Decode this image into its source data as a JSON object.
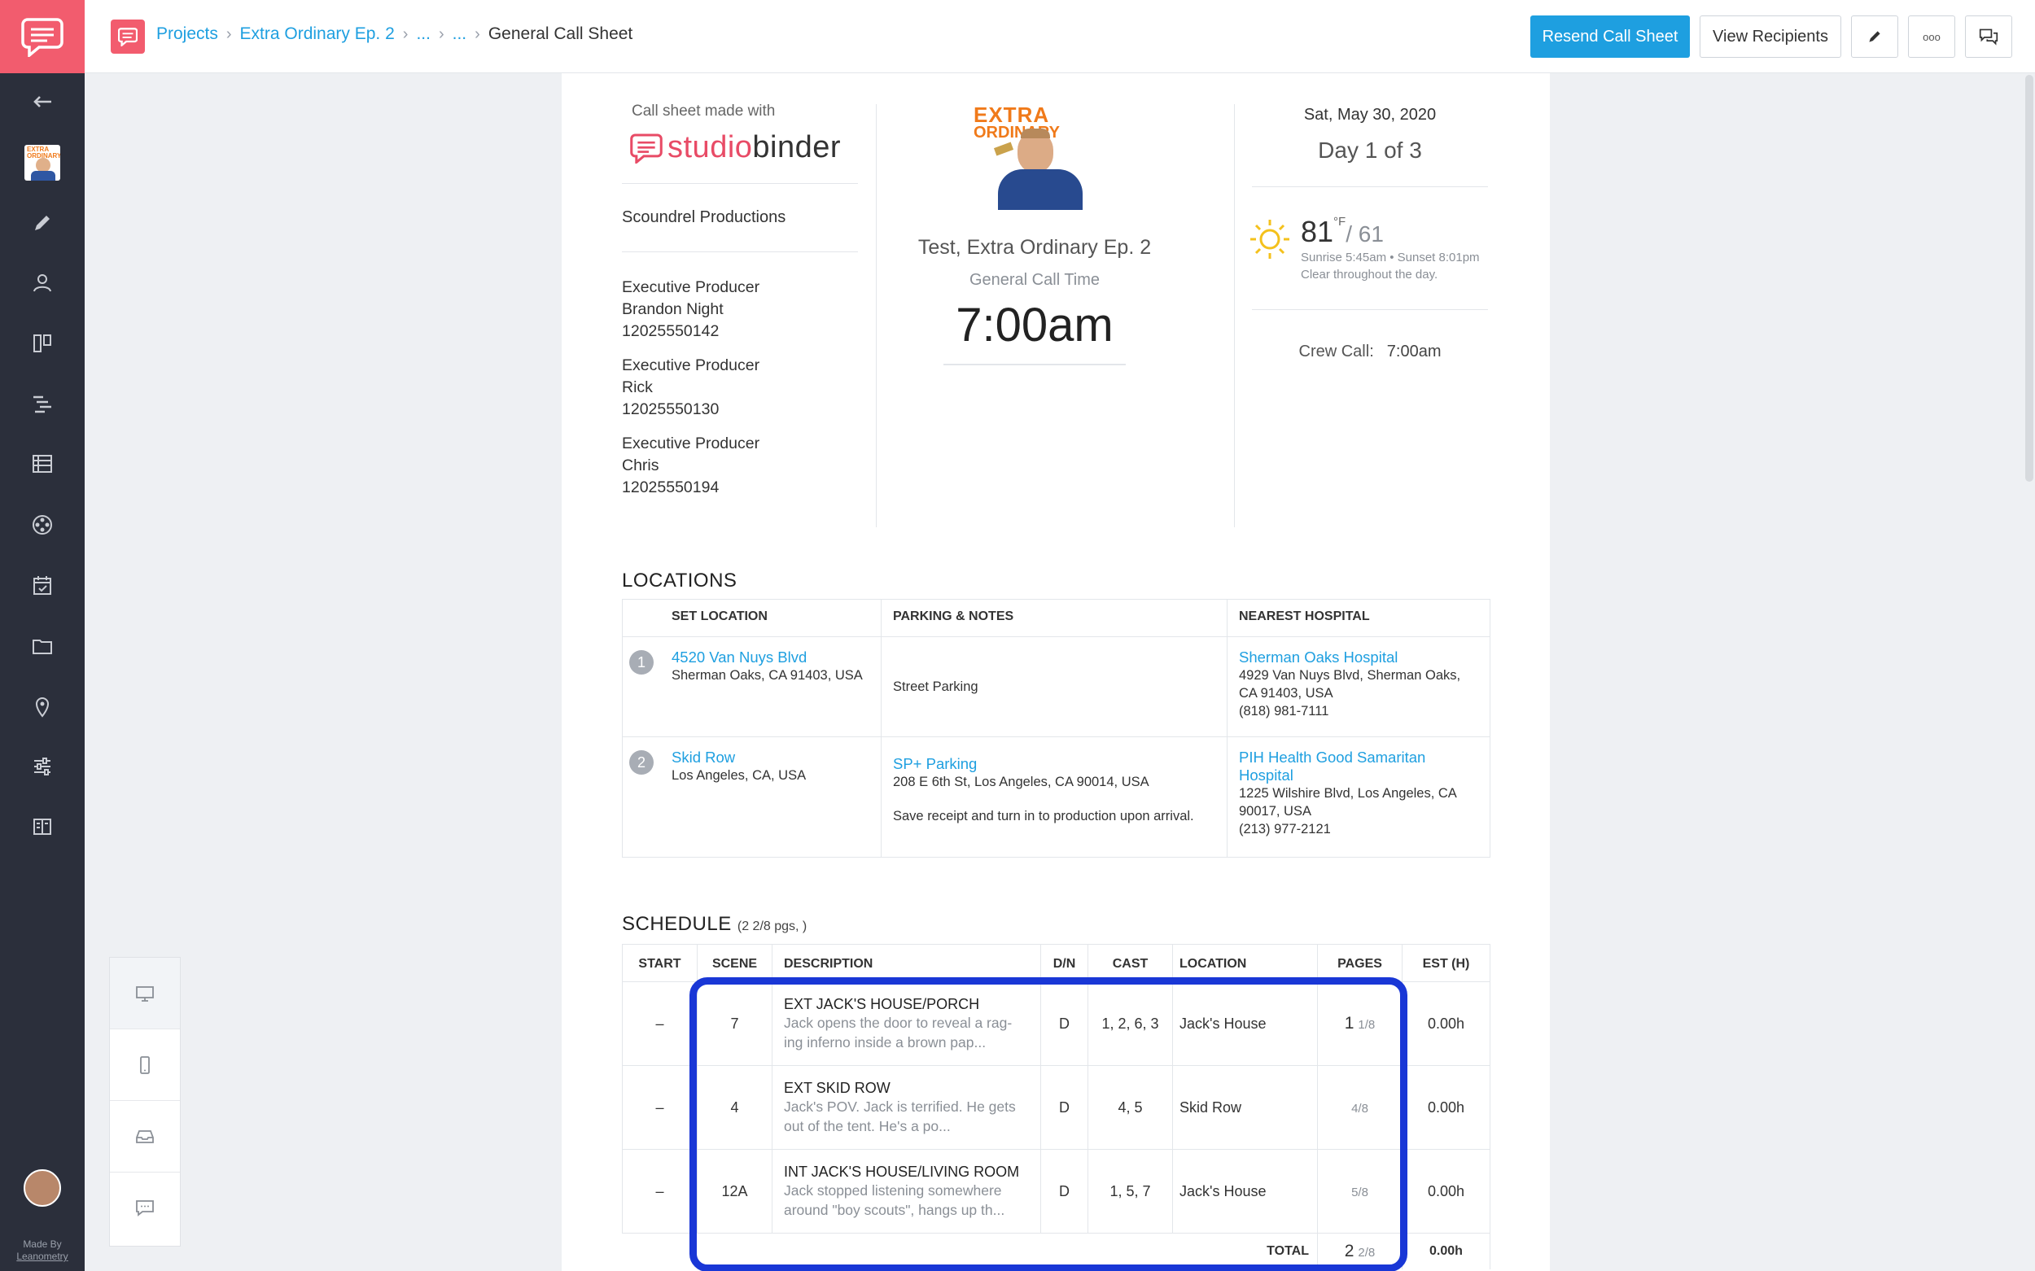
{
  "sidebar": {
    "icons": [
      "chat-logo-icon",
      "back-arrow-icon",
      "project-thumbnail",
      "pencil-icon",
      "user-group-icon",
      "board-icon",
      "gantt-icon",
      "list-icon",
      "film-reel-icon",
      "calendar-icon",
      "folder-icon",
      "location-pin-icon",
      "sliders-icon",
      "book-icon"
    ],
    "made_by_line1": "Made By",
    "made_by_line2": "Leanometry"
  },
  "breadcrumb": {
    "projects": "Projects",
    "episode": "Extra Ordinary Ep. 2",
    "ellipsis1": "...",
    "ellipsis2": "...",
    "current": "General Call Sheet"
  },
  "toolbar": {
    "resend_label": "Resend Call Sheet",
    "view_recipients_label": "View Recipients",
    "more_label": "ooo"
  },
  "header": {
    "made_with": "Call sheet made with",
    "brand_part1": "studio",
    "brand_part2": "binder",
    "company": "Scoundrel Productions",
    "producers": [
      {
        "role": "Executive Producer",
        "name": "Brandon Night",
        "phone": "12025550142"
      },
      {
        "role": "Executive Producer",
        "name": "Rick",
        "phone": "12025550130"
      },
      {
        "role": "Executive Producer",
        "name": "Chris",
        "phone": "12025550194"
      }
    ],
    "poster_line1": "EXTRA",
    "poster_line2": "ORDINARY",
    "show_title": "Test, Extra Ordinary Ep. 2",
    "general_call_label": "General Call Time",
    "general_call_time": "7:00am",
    "date": "Sat, May 30, 2020",
    "day": "Day 1 of 3",
    "temp_high": "81",
    "temp_unit": "°F",
    "temp_low": "/ 61",
    "sun_times": "Sunrise 5:45am • Sunset 8:01pm",
    "forecast": "Clear throughout the day.",
    "crew_call_label": "Crew Call:",
    "crew_call_time": "7:00am"
  },
  "locations": {
    "title": "LOCATIONS",
    "headers": [
      "SET LOCATION",
      "PARKING & NOTES",
      "NEAREST HOSPITAL"
    ],
    "rows": [
      {
        "num": "1",
        "name": "4520 Van Nuys Blvd",
        "address": "Sherman Oaks, CA 91403, USA",
        "parking_name": "",
        "parking_address": "",
        "notes": "Street Parking",
        "hospital_name": "Sherman Oaks Hospital",
        "hospital_address": "4929 Van Nuys Blvd, Sherman Oaks, CA 91403, USA",
        "hospital_phone": "(818) 981-7111"
      },
      {
        "num": "2",
        "name": "Skid Row",
        "address": "Los Angeles, CA, USA",
        "parking_name": "SP+ Parking",
        "parking_address": "208 E 6th St, Los Angeles, CA 90014, USA",
        "notes": "Save receipt and turn in to production upon arrival.",
        "hospital_name": "PIH Health Good Samaritan Hospital",
        "hospital_address": "1225 Wilshire Blvd, Los Angeles, CA 90017, USA",
        "hospital_phone": "(213) 977-2121"
      }
    ]
  },
  "schedule": {
    "title": "SCHEDULE",
    "subtitle": "(2 2/8 pgs, )",
    "headers": [
      "START",
      "SCENE",
      "DESCRIPTION",
      "D/N",
      "CAST",
      "LOCATION",
      "PAGES",
      "EST (H)"
    ],
    "rows": [
      {
        "start": "–",
        "scene": "7",
        "title": "EXT JACK'S HOUSE/PORCH",
        "desc1": "Jack opens the door to reveal a rag-",
        "desc2": "ing inferno inside a brown pap...",
        "dn": "D",
        "cast": "1, 2, 6, 3",
        "location": "Jack's House",
        "pages_whole": "1",
        "pages_frac": "1/8",
        "est": "0.00h"
      },
      {
        "start": "–",
        "scene": "4",
        "title": "EXT SKID ROW",
        "desc1": "Jack's POV. Jack is terrified. He gets",
        "desc2": "out of the tent. He's a po...",
        "dn": "D",
        "cast": "4, 5",
        "location": "Skid Row",
        "pages_whole": "",
        "pages_frac": "4/8",
        "est": "0.00h"
      },
      {
        "start": "–",
        "scene": "12A",
        "title": "INT JACK'S HOUSE/LIVING ROOM",
        "desc1": "Jack stopped listening somewhere",
        "desc2": "around \"boy scouts\", hangs up th...",
        "dn": "D",
        "cast": "1, 5, 7",
        "location": "Jack's House",
        "pages_whole": "",
        "pages_frac": "5/8",
        "est": "0.00h"
      }
    ],
    "total_label": "TOTAL",
    "total_whole": "2",
    "total_frac": "2/8",
    "total_est": "0.00h"
  },
  "colors": {
    "accent": "#1e9fe0",
    "brand": "#f25c6e",
    "highlight": "#1937d6",
    "sidebar": "#2b2f3b"
  }
}
